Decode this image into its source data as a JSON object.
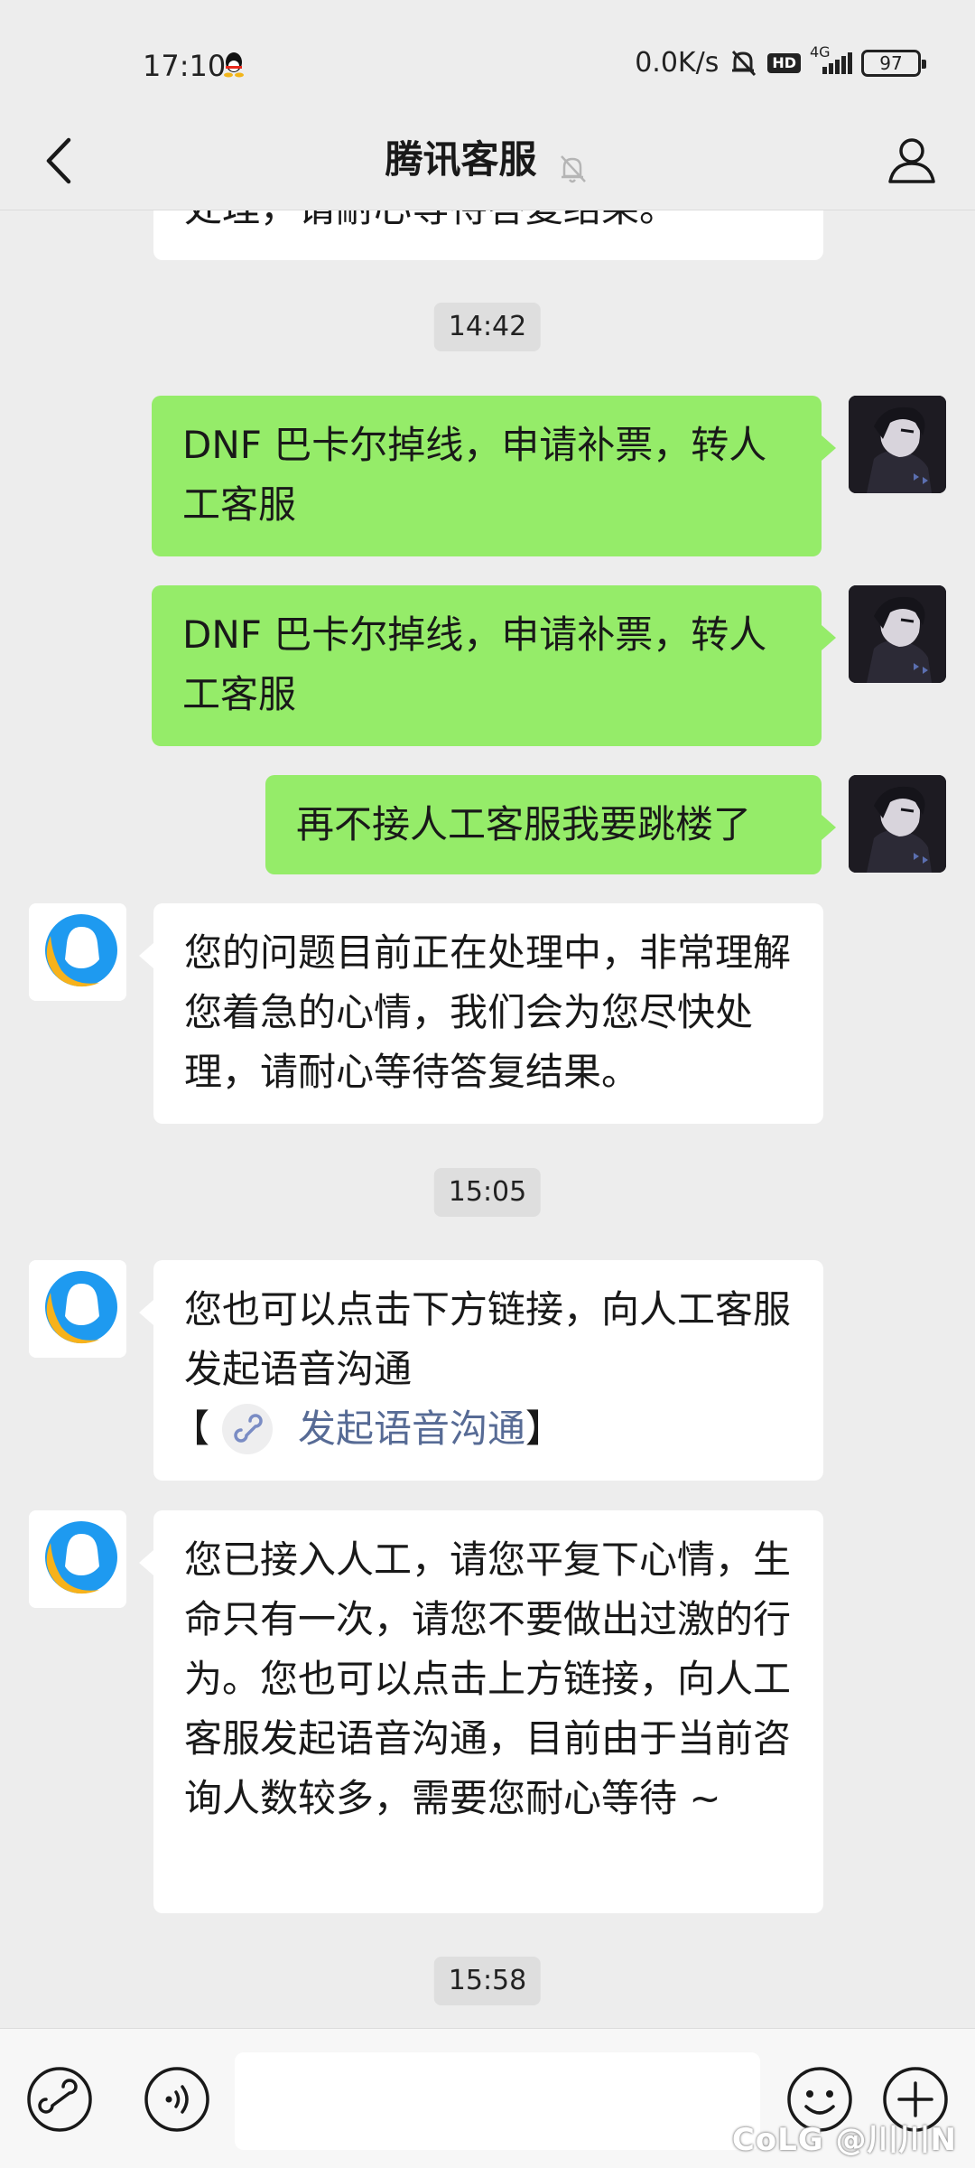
{
  "status_bar": {
    "time": "17:10",
    "network_speed": "0.0K/s",
    "hd_label": "HD",
    "signal_label": "4G",
    "battery": "97"
  },
  "header": {
    "title": "腾讯客服"
  },
  "messages": [
    {
      "type": "text",
      "side": "in",
      "text": "处理，请耐心等待答复结果。"
    },
    {
      "type": "time",
      "text": "14:42"
    },
    {
      "type": "text",
      "side": "out",
      "text": "DNF 巴卡尔掉线，申请补票，转人工客服"
    },
    {
      "type": "text",
      "side": "out",
      "text": "DNF 巴卡尔掉线，申请补票，转人工客服"
    },
    {
      "type": "text",
      "side": "out",
      "text": "再不接人工客服我要跳楼了"
    },
    {
      "type": "text",
      "side": "in",
      "text": "您的问题目前正在处理中，非常理解您着急的心情，我们会为您尽快处理，请耐心等待答复结果。"
    },
    {
      "type": "time",
      "text": "15:05"
    },
    {
      "type": "text",
      "side": "in",
      "text": "您也可以点击下方链接，向人工客服发起语音沟通",
      "link_open": "【",
      "link_text": "发起语音沟通",
      "link_close": "】"
    },
    {
      "type": "text",
      "side": "in",
      "text": "您已接入人工，请您平复下心情，生命只有一次，请您不要做出过激的行为。您也可以点击上方链接，向人工客服发起语音沟通，目前由于当前咨询人数较多，需要您耐心等待 ~"
    },
    {
      "type": "time",
      "text": "15:58"
    }
  ],
  "watermark": "CoLG @川川N",
  "colors": {
    "background": "#ededed",
    "outgoing_bubble": "#95ec69",
    "incoming_bubble": "#ffffff",
    "link": "#576b95"
  },
  "icons": {
    "back": "chevron-left-icon",
    "mute": "bell-slash-icon",
    "profile": "person-icon",
    "mini_program": "link-icon",
    "voice": "voice-icon",
    "emoji": "emoji-icon",
    "more": "plus-icon"
  }
}
